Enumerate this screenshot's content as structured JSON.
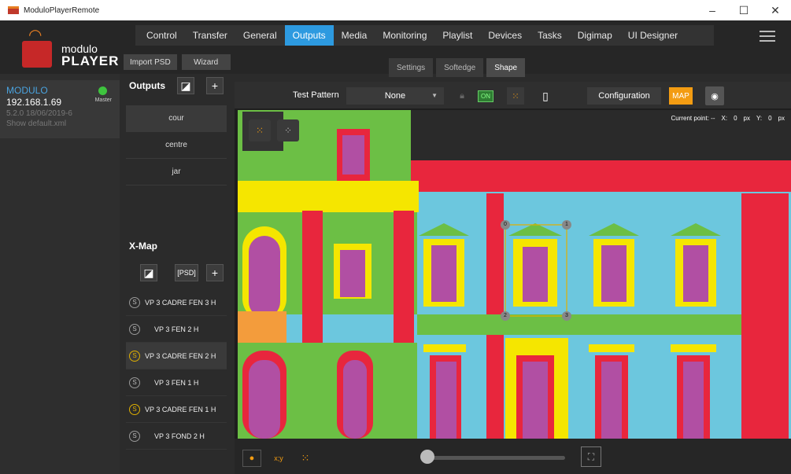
{
  "window": {
    "title": "ModuloPlayerRemote",
    "minimize": "–",
    "maximize": "☐",
    "close": "✕"
  },
  "logo": {
    "line1": "modulo",
    "line2": "PLAYER"
  },
  "nav": {
    "items": [
      "Control",
      "Transfer",
      "General",
      "Outputs",
      "Media",
      "Monitoring",
      "Playlist",
      "Devices",
      "Tasks",
      "Digimap",
      "UI Designer"
    ],
    "active": "Outputs"
  },
  "toolbar": {
    "import_psd": "Import PSD",
    "wizard": "Wizard"
  },
  "subtabs": {
    "items": [
      "Settings",
      "Softedge",
      "Shape"
    ],
    "active": "Shape"
  },
  "server": {
    "name": "MODULO",
    "ip": "192.168.1.69",
    "version": "5.2.0 18/06/2019-6",
    "show": "Show default.xml",
    "role": "Master",
    "status_color": "#3ec43e"
  },
  "outputs": {
    "heading": "Outputs",
    "items": [
      "cour",
      "centre",
      "jar"
    ],
    "selected": "cour",
    "add_label": "+"
  },
  "xmap": {
    "heading": "X-Map",
    "psd_label": "[PSD]",
    "add_label": "+",
    "items": [
      {
        "label": "VP 3 CADRE FEN 3 H",
        "badge": "S",
        "highlight": false
      },
      {
        "label": "VP 3 FEN 2 H",
        "badge": "S",
        "highlight": false
      },
      {
        "label": "VP 3 CADRE FEN 2 H",
        "badge": "S",
        "highlight": true
      },
      {
        "label": "VP 3 FEN 1 H",
        "badge": "S",
        "highlight": false
      },
      {
        "label": "VP 3 CADRE FEN 1 H",
        "badge": "S",
        "highlight": true
      },
      {
        "label": "VP 3 FOND 2 H",
        "badge": "S",
        "highlight": false
      }
    ]
  },
  "viewer": {
    "test_pattern_label": "Test Pattern",
    "test_pattern_value": "None",
    "on_label": "ON",
    "config_label": "Configuration",
    "map_label": "MAP",
    "current_point": "Current point: --",
    "x_label": "X:",
    "x_value": "0",
    "x_unit": "px",
    "y_label": "Y:",
    "y_value": "0",
    "y_unit": "px",
    "xy_label": "x;y",
    "points": [
      "0",
      "1",
      "2",
      "3"
    ],
    "accent": "#f39c12",
    "nav_accent": "#2d9ae0"
  }
}
